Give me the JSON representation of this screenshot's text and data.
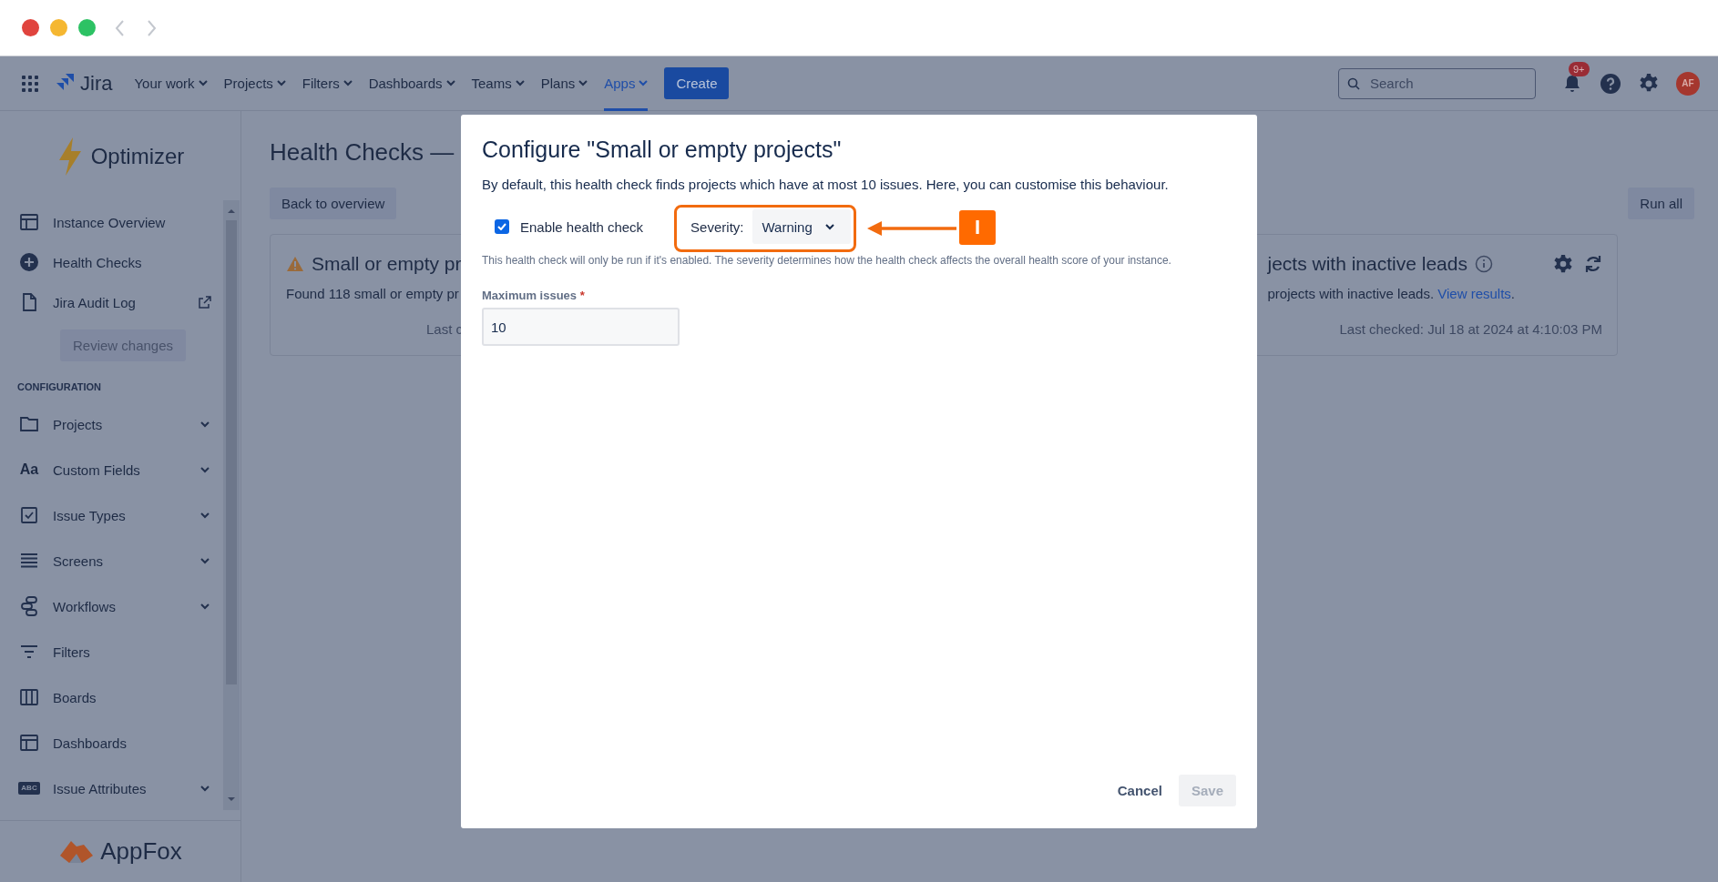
{
  "nav": {
    "product": "Jira",
    "items": [
      {
        "label": "Your work",
        "selected": false
      },
      {
        "label": "Projects",
        "selected": false
      },
      {
        "label": "Filters",
        "selected": false
      },
      {
        "label": "Dashboards",
        "selected": false
      },
      {
        "label": "Teams",
        "selected": false
      },
      {
        "label": "Plans",
        "selected": false
      },
      {
        "label": "Apps",
        "selected": true
      }
    ],
    "create": "Create",
    "search_placeholder": "Search",
    "notification_badge": "9+",
    "avatar": "AF"
  },
  "sidebar": {
    "app_name": "Optimizer",
    "items": [
      {
        "kind": "overview",
        "label": "Instance Overview",
        "external": false
      },
      {
        "kind": "plus",
        "label": "Health Checks",
        "external": false
      },
      {
        "kind": "file",
        "label": "Jira Audit Log",
        "external": true
      }
    ],
    "review_button": {
      "label": "Review changes",
      "disabled": true
    },
    "section_heading": "CONFIGURATION",
    "config_items": [
      {
        "kind": "folder",
        "label": "Projects",
        "expandable": true
      },
      {
        "kind": "text",
        "icon_text": "Aa",
        "label": "Custom Fields",
        "expandable": true
      },
      {
        "kind": "checkbox",
        "label": "Issue Types",
        "expandable": true
      },
      {
        "kind": "lines",
        "label": "Screens",
        "expandable": true
      },
      {
        "kind": "workflow",
        "label": "Workflows",
        "expandable": true
      },
      {
        "kind": "filter",
        "label": "Filters",
        "expandable": false
      },
      {
        "kind": "columns",
        "label": "Boards",
        "expandable": false
      },
      {
        "kind": "overview",
        "label": "Dashboards",
        "expandable": false
      },
      {
        "kind": "badge",
        "icon_text": "ABC",
        "label": "Issue Attributes",
        "expandable": true
      }
    ],
    "footer_brand": "AppFox"
  },
  "page": {
    "title": "Health Checks —",
    "back_button": "Back to overview",
    "run_all_button": "Run all",
    "cards": [
      {
        "kind": "warning",
        "title": "Small or empty pr",
        "text": "Found 118 small or empty pr",
        "footer": "Last c"
      },
      {
        "kind": "info",
        "title": "jects with inactive leads",
        "text": "projects with inactive leads.",
        "link": "View results",
        "after": ".",
        "footer": "Last checked: Jul 18 at 2024 at 4:10:03 PM"
      }
    ]
  },
  "dialog": {
    "title": "Configure \"Small or empty projects\"",
    "description": "By default, this health check finds projects which have at most 10 issues. Here, you can customise this behaviour.",
    "enable": {
      "label": "Enable health check",
      "checked": true
    },
    "severity": {
      "label": "Severity:",
      "value": "Warning"
    },
    "help": "This health check will only be run if it's enabled. The severity determines how the health check affects the overall health score of your instance.",
    "field": {
      "label": "Maximum issues",
      "required_mark": "*",
      "value": "10"
    },
    "cancel": "Cancel",
    "save": {
      "label": "Save",
      "disabled": true
    }
  },
  "annotation": {
    "tag": "I"
  }
}
